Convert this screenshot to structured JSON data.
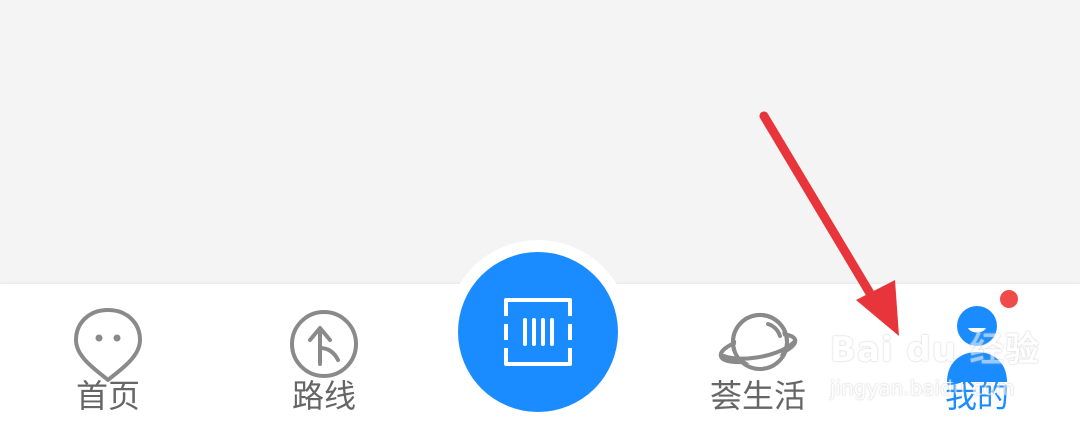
{
  "tabbar": {
    "tabs": [
      {
        "label": "首页",
        "icon": "face-pin-icon",
        "active": false
      },
      {
        "label": "路线",
        "icon": "route-arrow-icon",
        "active": false
      },
      {
        "label": "",
        "icon": "barcode-scan-icon",
        "active": false
      },
      {
        "label": "荟生活",
        "icon": "planet-icon",
        "active": false
      },
      {
        "label": "我的",
        "icon": "user-profile-icon",
        "active": true,
        "badge": true
      }
    ]
  },
  "watermark": {
    "brand": "Bai du 经验",
    "sub": "jingyan.baidu.com"
  },
  "colors": {
    "accent": "#1a8cff",
    "inactive": "#666666",
    "badge": "#f04a4a",
    "annotation_arrow": "#e8353b",
    "background": "#f4f4f5"
  }
}
